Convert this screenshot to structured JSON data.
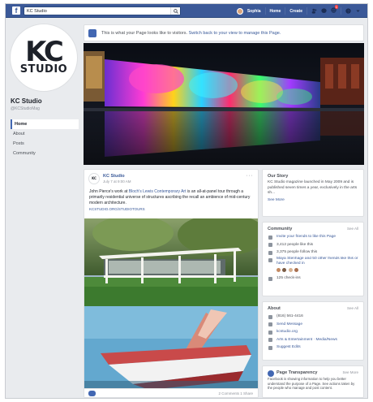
{
  "topbar": {
    "search_value": "KC Studio",
    "user_name": "Sophia",
    "home_label": "Home",
    "create_label": "Create",
    "notification_count": "1"
  },
  "page": {
    "logo_line1": "KC",
    "logo_line2": "STUDIO",
    "name": "KC Studio",
    "handle": "@KCStudioMag",
    "nav": [
      "Home",
      "About",
      "Posts",
      "Community"
    ]
  },
  "banner": {
    "text": "This is what your Page looks like to visitors.",
    "link": "Switch back to your view to manage this Page."
  },
  "post": {
    "author": "KC Studio",
    "time": "July 7 at 9:00 AM",
    "more": "···",
    "text_lead": "John Pierce's work at ",
    "text_link": "Bloch's Lewis Contemporary Art",
    "text_rest": " is an all-at-panel tour through a primarily residential universe of structures ascribing the recall an ambience of mid-century modern architecture.",
    "url": "KCSTUDIO.ORG/STUDIOTOURS",
    "stats": "2 Comments  1 Share"
  },
  "our_story": {
    "title": "Our Story",
    "body": "KC Studio magazine launched in May 2009 and is published seven times a year, exclusively in the arts sh...",
    "see_more": "See More"
  },
  "community": {
    "title": "Community",
    "see_all": "See All",
    "rows": [
      "Invite your friends to like this Page",
      "3,412 people like this",
      "3,375 people follow this",
      "Maya Stenhage and 50 other friends like this or have checked in",
      "",
      "125 check-ins"
    ]
  },
  "about": {
    "title": "About",
    "see_all": "See All",
    "rows": [
      "(816) 561-4416",
      "Send Message",
      "kcstudio.org",
      "Arts & Entertainment · Media/News",
      "Suggest Edits"
    ]
  },
  "transparency": {
    "title": "Page Transparency",
    "see_more": "See More",
    "body": "Facebook is showing information to help you better understand the purpose of a Page. See actions taken by the people who manage and post content."
  },
  "colors": {
    "brand_blue": "#3b5998",
    "link_blue": "#385898",
    "page_bg": "#e9ebee"
  }
}
